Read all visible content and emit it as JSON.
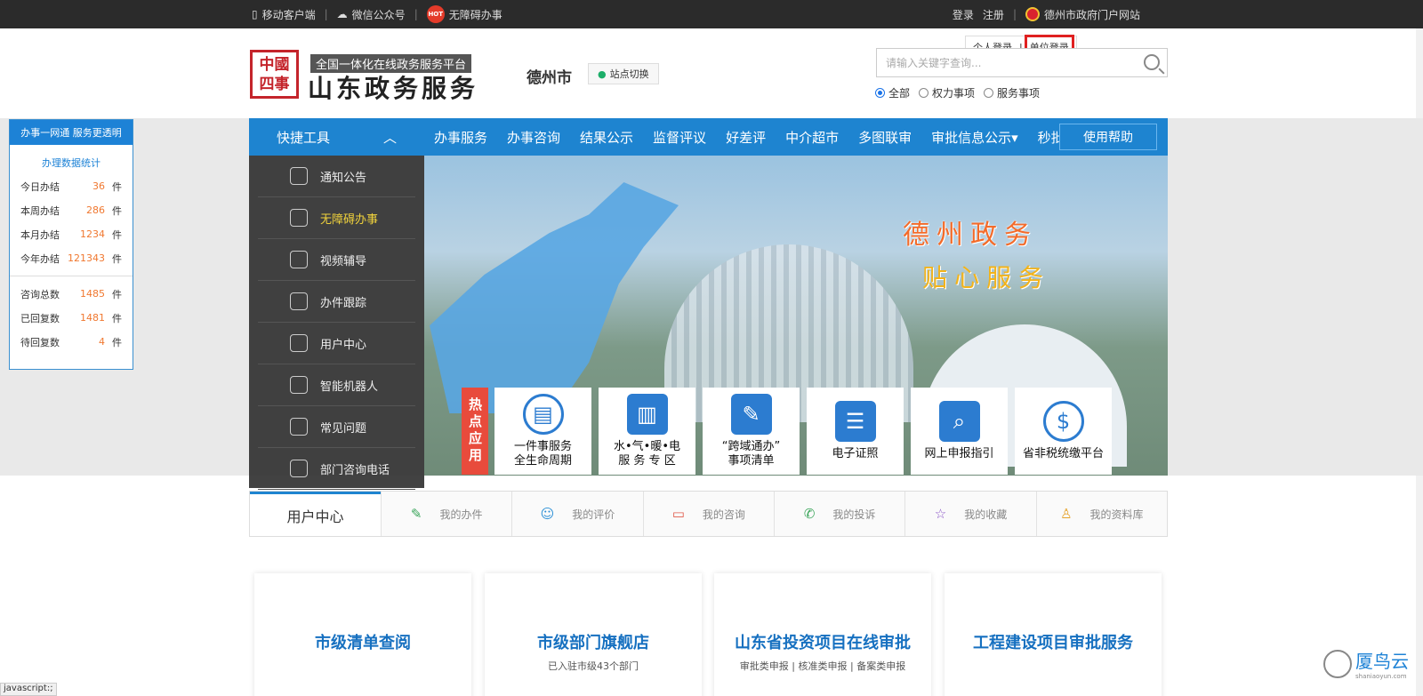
{
  "topbar": {
    "mobile": "移动客户端",
    "wechat": "微信公众号",
    "hot_badge": "HOT",
    "accessible": "无障碍办事",
    "login": "登录",
    "register": "注册",
    "gov_portal": "德州市政府门户网站"
  },
  "login_popup": {
    "personal": "个人登录",
    "sep": "|",
    "unit": "单位登录"
  },
  "header": {
    "logo_text": "中國四事",
    "brand_sub": "全国一体化在线政务服务平台",
    "brand_main": "山东政务服务",
    "city": "德州市",
    "switch_label": "站点切换",
    "search_placeholder": "请输入关键字查询...",
    "radios": [
      "全部",
      "权力事项",
      "服务事项"
    ]
  },
  "stats": {
    "title": "办事一网通  服务更透明",
    "subtitle": "办理数据统计",
    "unit": "件",
    "group1": [
      {
        "label": "今日办结",
        "value": "36"
      },
      {
        "label": "本周办结",
        "value": "286"
      },
      {
        "label": "本月办结",
        "value": "1234"
      },
      {
        "label": "今年办结",
        "value": "121343"
      }
    ],
    "group2": [
      {
        "label": "咨询总数",
        "value": "1485"
      },
      {
        "label": "已回复数",
        "value": "1481"
      },
      {
        "label": "待回复数",
        "value": "4"
      }
    ]
  },
  "nav": {
    "quick": "快捷工具",
    "items": [
      "办事服务",
      "办事咨询",
      "结果公示",
      "监督评议",
      "好差评",
      "中介超市",
      "多图联审",
      "审批信息公示▾",
      "秒批"
    ],
    "help": "使用帮助"
  },
  "tools": [
    "通知公告",
    "无障碍办事",
    "视频辅导",
    "办件跟踪",
    "用户中心",
    "智能机器人",
    "常见问题",
    "部门咨询电话"
  ],
  "banner": {
    "line1": "德州政务",
    "line2": "贴心服务"
  },
  "hot_apps": {
    "label": "热点应用",
    "apps": [
      {
        "line1": "一件事服务",
        "line2": "全生命周期",
        "icon": "document-icon"
      },
      {
        "line1": "水•气•暖•电",
        "line2": "服 务 专 区",
        "icon": "building-icon"
      },
      {
        "line1": "“跨域通办”",
        "line2": "事项清单",
        "icon": "edit-icon"
      },
      {
        "line1": "电子证照",
        "line2": "",
        "icon": "id-card-icon"
      },
      {
        "line1": "网上申报指引",
        "line2": "",
        "icon": "search-doc-icon"
      },
      {
        "line1": "省非税统缴平台",
        "line2": "",
        "icon": "money-bag-icon"
      }
    ]
  },
  "user_center": {
    "title": "用户中心",
    "tabs": [
      "我的办件",
      "我的评价",
      "我的咨询",
      "我的投诉",
      "我的收藏",
      "我的资料库"
    ],
    "tab_icons": [
      "✎",
      "☺",
      "▭",
      "✆",
      "☆",
      "♙"
    ],
    "tab_colors": [
      "#3aa55a",
      "#2b8fd6",
      "#e05a4a",
      "#3aa55a",
      "#8a55c8",
      "#e6a22a"
    ]
  },
  "cards": [
    {
      "title": "市级清单查阅",
      "sub": ""
    },
    {
      "title": "市级部门旗舰店",
      "sub": "已入驻市级43个部门"
    },
    {
      "title": "山东省投资项目在线审批",
      "sub": "审批类申报  |  核准类申报  |  备案类申报"
    },
    {
      "title": "工程建设项目审批服务",
      "sub": ""
    }
  ],
  "status_bar": "javascript:;",
  "watermark": {
    "name": "厦鸟云",
    "domain": "shaniaoyun.com"
  }
}
